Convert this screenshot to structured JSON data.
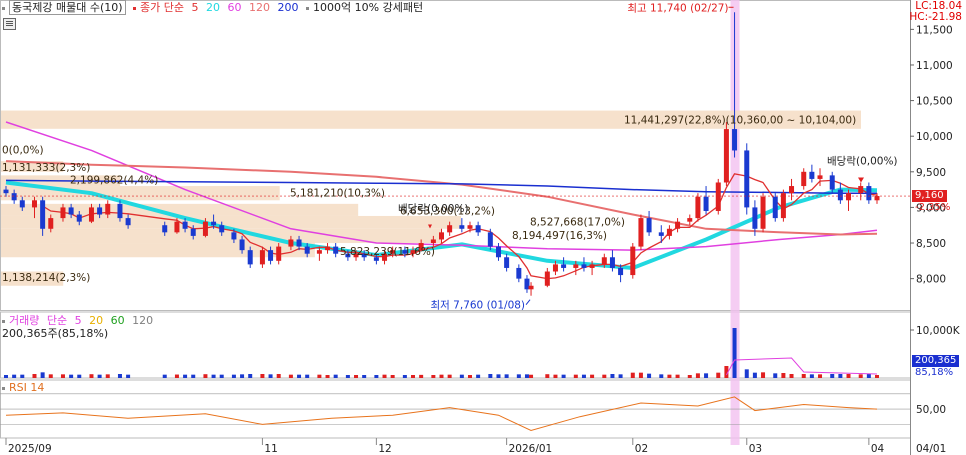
{
  "legend_main": {
    "stock_name": "동국제강 매물대 수(10)",
    "ma_label": "종가 단순",
    "ma_periods": [
      "5",
      "20",
      "60",
      "120",
      "200"
    ],
    "ma_colors": [
      "#e03030",
      "#21d8e0",
      "#e040e0",
      "#e87070",
      "#1a2fd0"
    ],
    "extra": "1000억 10% 강세패턴"
  },
  "corner": {
    "lc": "LC:18.04",
    "hc": "HC:-21.98"
  },
  "legend_volume": {
    "label": "거래량",
    "ma_label": "단순",
    "ma_periods": [
      "5",
      "20",
      "60",
      "120"
    ],
    "ma_colors": [
      "#e040e0",
      "#e8b000",
      "#20a020",
      "#808080"
    ],
    "current": "200,365주(85,18%)"
  },
  "legend_rsi": {
    "label": "RSI 14"
  },
  "price_axis": [
    "11,500",
    "11,000",
    "10,500",
    "10,000",
    "9,500",
    "9,000",
    "8,500",
    "8,000"
  ],
  "current_price": {
    "value": "9,160",
    "change": "-2.35%"
  },
  "volume_axis": {
    "top": "10,000K",
    "current": "200,365",
    "pct": "85,18%"
  },
  "rsi_axis": {
    "mid": "50,00"
  },
  "date_axis": [
    "2025/09",
    "11",
    "12",
    "2026/01",
    "02",
    "03",
    "04",
    "04/01"
  ],
  "annotations": {
    "high": "최고 11,740 (02/27)",
    "low": "최저 7,760 (01/08)",
    "dividend1": "배당락(0.00%)",
    "dividend2": "배당락(0,00%)"
  },
  "volume_profile": [
    "11,441,297(22,8%)(10,360,00 ~ 10,104,00)",
    "0(0,0%)",
    "1,131,333(2,3%)",
    "2,199,862(4,4%)",
    "5,181,210(10,3%)",
    "6,653,300(13,2%)",
    "8,527,668(17,0%)",
    "8,194,497(16,3%)",
    "5,823,239(11,6%)",
    "1,138,214(2,3%)"
  ],
  "chart_data": {
    "type": "candlestick",
    "x_range": [
      "2025-09-01",
      "2026-04-03"
    ],
    "ylim": [
      7700,
      11800
    ],
    "candles": [
      [
        "2025-09-01",
        9250,
        9300,
        9150,
        9200
      ],
      [
        "2025-09-03",
        9200,
        9250,
        9050,
        9100
      ],
      [
        "2025-09-05",
        9100,
        9150,
        8950,
        9000
      ],
      [
        "2025-09-08",
        9000,
        9150,
        8850,
        9100
      ],
      [
        "2025-09-10",
        9100,
        9150,
        8600,
        8700
      ],
      [
        "2025-09-12",
        8700,
        8900,
        8650,
        8850
      ],
      [
        "2025-09-15",
        8850,
        9050,
        8800,
        9000
      ],
      [
        "2025-09-17",
        9000,
        9050,
        8850,
        8900
      ],
      [
        "2025-09-19",
        8900,
        8950,
        8750,
        8800
      ],
      [
        "2025-09-22",
        8800,
        9050,
        8780,
        9000
      ],
      [
        "2025-09-24",
        9000,
        9050,
        8850,
        8900
      ],
      [
        "2025-09-26",
        8900,
        9100,
        8850,
        9050
      ],
      [
        "2025-09-29",
        9050,
        9100,
        8800,
        8850
      ],
      [
        "2025-10-01",
        8850,
        8900,
        8700,
        8750
      ],
      [
        "2025-10-10",
        8750,
        8800,
        8600,
        8650
      ],
      [
        "2025-10-13",
        8650,
        8850,
        8630,
        8800
      ],
      [
        "2025-10-15",
        8800,
        8850,
        8650,
        8700
      ],
      [
        "2025-10-17",
        8700,
        8750,
        8550,
        8600
      ],
      [
        "2025-10-20",
        8600,
        8850,
        8580,
        8800
      ],
      [
        "2025-10-22",
        8800,
        8900,
        8700,
        8750
      ],
      [
        "2025-10-24",
        8750,
        8800,
        8600,
        8650
      ],
      [
        "2025-10-27",
        8650,
        8700,
        8500,
        8550
      ],
      [
        "2025-10-29",
        8550,
        8600,
        8350,
        8400
      ],
      [
        "2025-10-31",
        8400,
        8450,
        8150,
        8200
      ],
      [
        "2025-11-03",
        8200,
        8450,
        8150,
        8400
      ],
      [
        "2025-11-05",
        8400,
        8450,
        8200,
        8250
      ],
      [
        "2025-11-07",
        8250,
        8500,
        8200,
        8450
      ],
      [
        "2025-11-10",
        8450,
        8600,
        8400,
        8550
      ],
      [
        "2025-11-12",
        8550,
        8600,
        8400,
        8450
      ],
      [
        "2025-11-14",
        8450,
        8500,
        8300,
        8350
      ],
      [
        "2025-11-17",
        8350,
        8450,
        8250,
        8400
      ],
      [
        "2025-11-19",
        8400,
        8500,
        8350,
        8450
      ],
      [
        "2025-11-21",
        8450,
        8500,
        8300,
        8350
      ],
      [
        "2025-11-24",
        8350,
        8400,
        8250,
        8300
      ],
      [
        "2025-11-26",
        8300,
        8400,
        8250,
        8350
      ],
      [
        "2025-11-28",
        8350,
        8400,
        8250,
        8300
      ],
      [
        "2025-12-01",
        8300,
        8350,
        8200,
        8250
      ],
      [
        "2025-12-03",
        8250,
        8400,
        8200,
        8350
      ],
      [
        "2025-12-05",
        8350,
        8450,
        8300,
        8400
      ],
      [
        "2025-12-08",
        8400,
        8450,
        8300,
        8350
      ],
      [
        "2025-12-10",
        8350,
        8450,
        8300,
        8400
      ],
      [
        "2025-12-12",
        8400,
        8550,
        8380,
        8500
      ],
      [
        "2025-12-15",
        8500,
        8600,
        8450,
        8550
      ],
      [
        "2025-12-17",
        8550,
        8700,
        8500,
        8650
      ],
      [
        "2025-12-19",
        8650,
        8800,
        8600,
        8750
      ],
      [
        "2025-12-22",
        8750,
        8850,
        8650,
        8700
      ],
      [
        "2025-12-24",
        8700,
        8800,
        8650,
        8750
      ],
      [
        "2025-12-26",
        8750,
        8800,
        8600,
        8650
      ],
      [
        "2025-12-29",
        8650,
        8700,
        8400,
        8450
      ],
      [
        "2025-12-31",
        8450,
        8500,
        8250,
        8300
      ],
      [
        "2026-01-02",
        8300,
        8350,
        8100,
        8150
      ],
      [
        "2026-01-05",
        8150,
        8200,
        7950,
        8000
      ],
      [
        "2026-01-07",
        8000,
        8050,
        7800,
        7850
      ],
      [
        "2026-01-08",
        7850,
        7950,
        7760,
        7900
      ],
      [
        "2026-01-12",
        7900,
        8150,
        7880,
        8100
      ],
      [
        "2026-01-14",
        8100,
        8250,
        8050,
        8200
      ],
      [
        "2026-01-16",
        8200,
        8300,
        8100,
        8150
      ],
      [
        "2026-01-19",
        8150,
        8250,
        8050,
        8200
      ],
      [
        "2026-01-21",
        8200,
        8300,
        8100,
        8150
      ],
      [
        "2026-01-23",
        8150,
        8250,
        8050,
        8200
      ],
      [
        "2026-01-26",
        8200,
        8350,
        8150,
        8300
      ],
      [
        "2026-01-28",
        8300,
        8400,
        8100,
        8150
      ],
      [
        "2026-01-30",
        8150,
        8200,
        7950,
        8050
      ],
      [
        "2026-02-02",
        8050,
        8500,
        8000,
        8450
      ],
      [
        "2026-02-04",
        8450,
        8900,
        8400,
        8850
      ],
      [
        "2026-02-06",
        8850,
        8950,
        8600,
        8650
      ],
      [
        "2026-02-09",
        8650,
        8750,
        8500,
        8600
      ],
      [
        "2026-02-11",
        8600,
        8750,
        8550,
        8700
      ],
      [
        "2026-02-13",
        8700,
        8850,
        8650,
        8800
      ],
      [
        "2026-02-16",
        8800,
        8900,
        8750,
        8850
      ],
      [
        "2026-02-18",
        8850,
        9200,
        8800,
        9150
      ],
      [
        "2026-02-20",
        9150,
        9300,
        8900,
        8950
      ],
      [
        "2026-02-23",
        8950,
        9400,
        8900,
        9350
      ],
      [
        "2026-02-25",
        9350,
        10200,
        9300,
        10100
      ],
      [
        "2026-02-27",
        10100,
        11740,
        9700,
        9800
      ],
      [
        "2026-03-02",
        9800,
        9900,
        8900,
        9000
      ],
      [
        "2026-03-04",
        9000,
        9100,
        8600,
        8700
      ],
      [
        "2026-03-06",
        8700,
        9200,
        8650,
        9150
      ],
      [
        "2026-03-09",
        9150,
        9200,
        8800,
        8850
      ],
      [
        "2026-03-11",
        8850,
        9250,
        8800,
        9200
      ],
      [
        "2026-03-13",
        9200,
        9400,
        9100,
        9300
      ],
      [
        "2026-03-16",
        9300,
        9550,
        9250,
        9500
      ],
      [
        "2026-03-18",
        9500,
        9600,
        9350,
        9400
      ],
      [
        "2026-03-20",
        9400,
        9550,
        9300,
        9450
      ],
      [
        "2026-03-23",
        9450,
        9500,
        9200,
        9250
      ],
      [
        "2026-03-25",
        9250,
        9350,
        9050,
        9100
      ],
      [
        "2026-03-27",
        9100,
        9250,
        8950,
        9200
      ],
      [
        "2026-03-30",
        9200,
        9350,
        9100,
        9300
      ],
      [
        "2026-04-01",
        9300,
        9350,
        9050,
        9100
      ],
      [
        "2026-04-03",
        9100,
        9200,
        9050,
        9160
      ]
    ],
    "ma_series": [
      {
        "name": "20",
        "points": [
          [
            "2025-09-01",
            9350
          ],
          [
            "2025-09-22",
            9200
          ],
          [
            "2025-10-15",
            8850
          ],
          [
            "2025-11-10",
            8500
          ],
          [
            "2025-12-01",
            8330
          ],
          [
            "2025-12-22",
            8480
          ],
          [
            "2026-01-12",
            8250
          ],
          [
            "2026-02-02",
            8150
          ],
          [
            "2026-02-20",
            8550
          ],
          [
            "2026-03-10",
            9000
          ],
          [
            "2026-03-25",
            9250
          ],
          [
            "2026-04-03",
            9240
          ]
        ]
      },
      {
        "name": "60",
        "points": [
          [
            "2025-09-01",
            10200
          ],
          [
            "2025-09-22",
            9800
          ],
          [
            "2025-10-15",
            9250
          ],
          [
            "2025-11-10",
            8700
          ],
          [
            "2025-12-01",
            8500
          ],
          [
            "2025-12-22",
            8470
          ],
          [
            "2026-01-12",
            8420
          ],
          [
            "2026-02-02",
            8400
          ],
          [
            "2026-02-20",
            8450
          ],
          [
            "2026-03-10",
            8550
          ],
          [
            "2026-03-25",
            8620
          ],
          [
            "2026-04-03",
            8680
          ]
        ]
      },
      {
        "name": "120",
        "points": [
          [
            "2025-09-01",
            9650
          ],
          [
            "2025-09-22",
            9600
          ],
          [
            "2025-10-15",
            9560
          ],
          [
            "2025-11-10",
            9500
          ],
          [
            "2025-12-01",
            9430
          ],
          [
            "2025-12-22",
            9320
          ],
          [
            "2026-01-12",
            9150
          ],
          [
            "2026-02-02",
            8900
          ],
          [
            "2026-02-20",
            8700
          ],
          [
            "2026-03-10",
            8650
          ],
          [
            "2026-03-25",
            8620
          ],
          [
            "2026-04-03",
            8630
          ]
        ]
      },
      {
        "name": "200",
        "points": [
          [
            "2025-09-01",
            9380
          ],
          [
            "2025-09-22",
            9370
          ],
          [
            "2025-10-15",
            9360
          ],
          [
            "2025-11-10",
            9350
          ],
          [
            "2025-12-01",
            9340
          ],
          [
            "2025-12-22",
            9330
          ],
          [
            "2026-01-12",
            9300
          ],
          [
            "2026-02-02",
            9250
          ],
          [
            "2026-02-20",
            9220
          ],
          [
            "2026-03-10",
            9210
          ],
          [
            "2026-03-25",
            9200
          ],
          [
            "2026-04-03",
            9200
          ]
        ]
      }
    ],
    "volume_profile_bins": [
      {
        "from": 10360,
        "to": 10104,
        "volume": 11441297,
        "pct": 22.8
      },
      {
        "from": 9900,
        "to": 9700,
        "volume": 0,
        "pct": 0.0
      },
      {
        "from": 9650,
        "to": 9500,
        "volume": 1131333,
        "pct": 2.3
      },
      {
        "from": 9450,
        "to": 9300,
        "volume": 2199862,
        "pct": 4.4
      },
      {
        "from": 9300,
        "to": 9100,
        "volume": 5181210,
        "pct": 10.3
      },
      {
        "from": 9050,
        "to": 8880,
        "volume": 6653300,
        "pct": 13.2
      },
      {
        "from": 8880,
        "to": 8700,
        "volume": 8527668,
        "pct": 17.0
      },
      {
        "from": 8700,
        "to": 8500,
        "volume": 8194497,
        "pct": 16.3
      },
      {
        "from": 8500,
        "to": 8300,
        "volume": 5823239,
        "pct": 11.6
      },
      {
        "from": 8100,
        "to": 7900,
        "volume": 1138214,
        "pct": 2.3
      }
    ],
    "rsi": [
      [
        "2025-09-01",
        42
      ],
      [
        "2025-09-15",
        45
      ],
      [
        "2025-10-01",
        38
      ],
      [
        "2025-10-20",
        44
      ],
      [
        "2025-11-03",
        30
      ],
      [
        "2025-11-20",
        38
      ],
      [
        "2025-12-05",
        42
      ],
      [
        "2025-12-19",
        52
      ],
      [
        "2025-12-31",
        42
      ],
      [
        "2026-01-08",
        22
      ],
      [
        "2026-01-20",
        40
      ],
      [
        "2026-02-04",
        58
      ],
      [
        "2026-02-18",
        54
      ],
      [
        "2026-02-27",
        66
      ],
      [
        "2026-03-04",
        48
      ],
      [
        "2026-03-16",
        56
      ],
      [
        "2026-03-27",
        52
      ],
      [
        "2026-04-03",
        50
      ]
    ],
    "rsi_ylim": [
      20,
      75
    ]
  }
}
